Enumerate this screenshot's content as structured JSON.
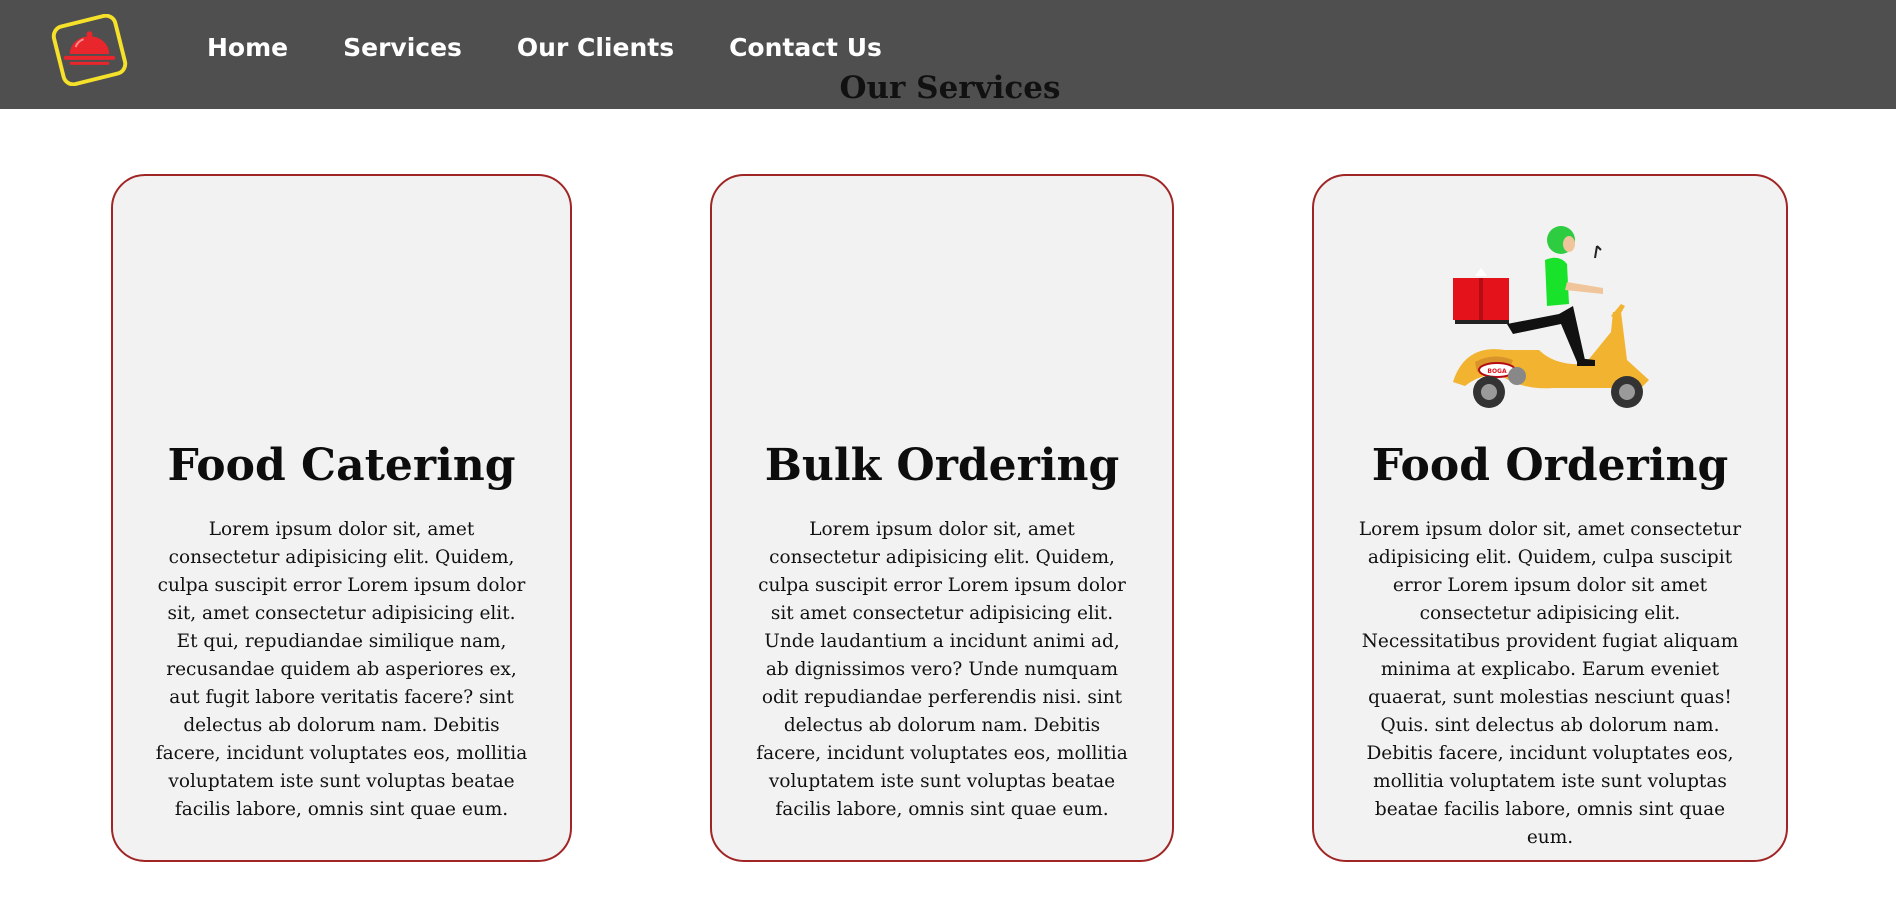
{
  "nav": {
    "logo_icon": "serving-cloche-icon",
    "links": [
      "Home",
      "Services",
      "Our Clients",
      "Contact Us"
    ]
  },
  "section": {
    "title": "Our Services"
  },
  "cards": [
    {
      "title": "Food Catering",
      "text": "Lorem ipsum dolor sit, amet consectetur adipisicing elit. Quidem, culpa suscipit error Lorem ipsum dolor sit, amet consectetur adipisicing elit. Et qui, repudiandae similique nam, recusandae quidem ab asperiores ex, aut fugit labore veritatis facere? sint delectus ab dolorum nam. Debitis facere, incidunt voluptates eos, mollitia voluptatem iste sunt voluptas beatae facilis labore, omnis sint quae eum."
    },
    {
      "title": "Bulk Ordering",
      "text": "Lorem ipsum dolor sit, amet consectetur adipisicing elit. Quidem, culpa suscipit error Lorem ipsum dolor sit amet consectetur adipisicing elit. Unde laudantium a incidunt animi ad, ab dignissimos vero? Unde numquam odit repudiandae perferendis nisi. sint delectus ab dolorum nam. Debitis facere, incidunt voluptates eos, mollitia voluptatem iste sunt voluptas beatae facilis labore, omnis sint quae eum."
    },
    {
      "title": "Food Ordering",
      "image_icon": "delivery-scooter-rider-icon",
      "text": "Lorem ipsum dolor sit, amet consectetur adipisicing elit. Quidem, culpa suscipit error Lorem ipsum dolor sit amet consectetur adipisicing elit. Necessitatibus provident fugiat aliquam minima at explicabo. Earum eveniet quaerat, sunt molestias nesciunt quas! Quis. sint delectus ab dolorum nam. Debitis facere, incidunt voluptates eos, mollitia voluptatem iste sunt voluptas beatae facilis labore, omnis sint quae eum."
    }
  ],
  "colors": {
    "navbar_bg": "#4f4f4f",
    "card_bg": "#f2f2f2",
    "card_border": "#a02525",
    "logo_accent": "#f5e02a",
    "logo_red": "#e8262c"
  }
}
